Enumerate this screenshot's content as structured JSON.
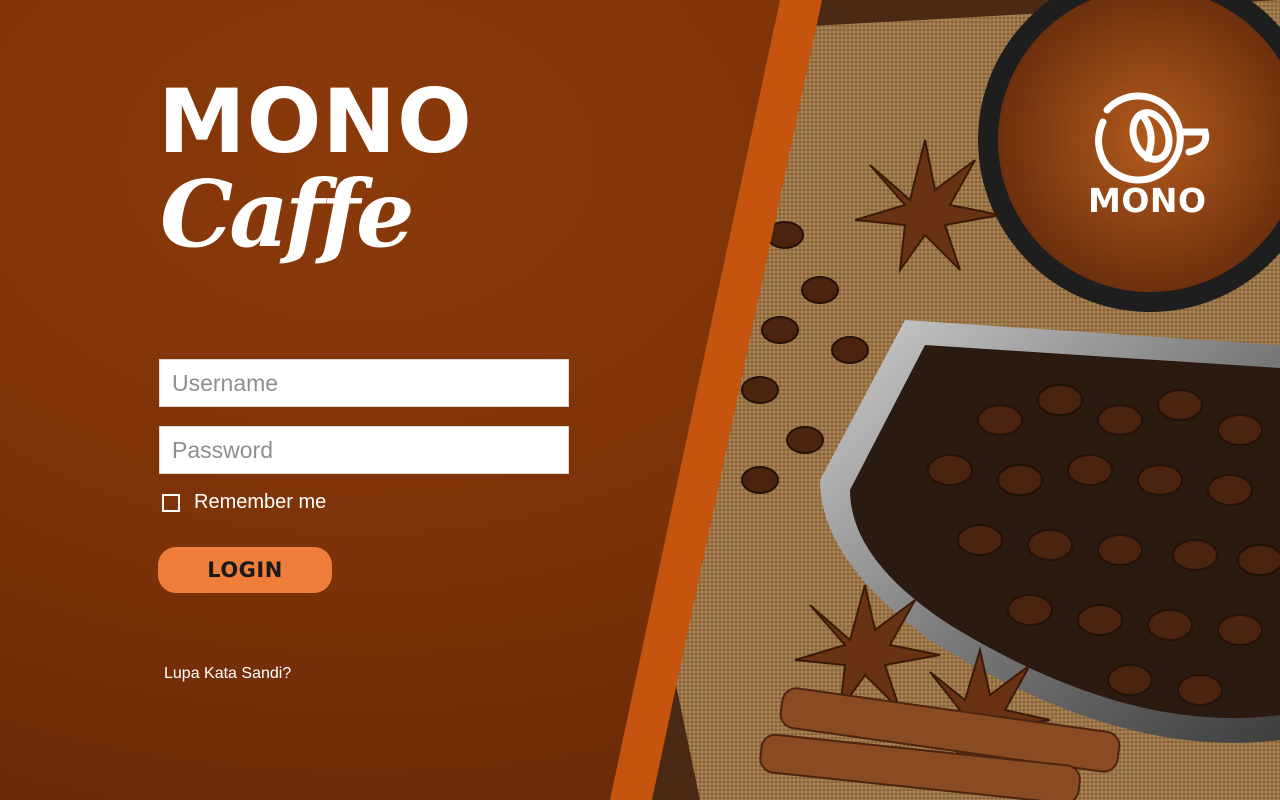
{
  "brand": {
    "title_line1": "MONO",
    "title_line2": "Caffe"
  },
  "form": {
    "username_placeholder": "Username",
    "password_placeholder": "Password",
    "remember_label": "Remember me",
    "login_label": "LOGIN",
    "forgot_label": "Lupa Kata Sandi?"
  },
  "photo_logo": {
    "text": "MONO"
  },
  "icons": {
    "logo": "coffee-cup-bean-icon",
    "checkbox": "checkbox-unchecked-icon"
  },
  "colors": {
    "panel": "#7d3208",
    "stripe": "#c4540e",
    "button": "#ee7e3a",
    "text": "#ffffff"
  }
}
